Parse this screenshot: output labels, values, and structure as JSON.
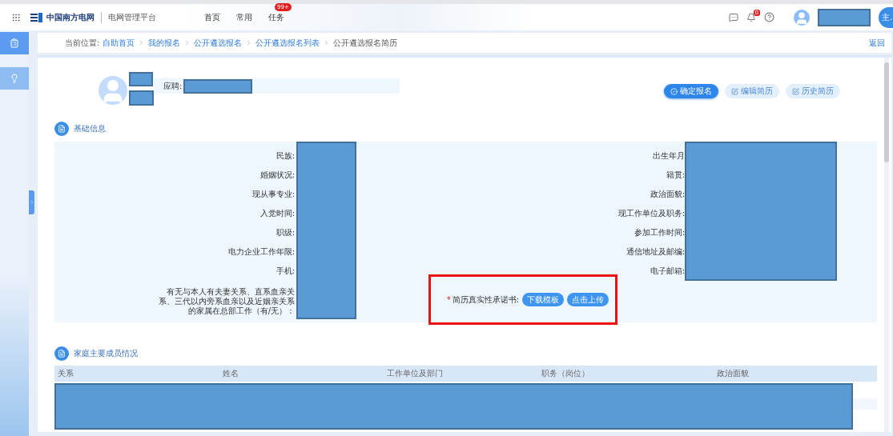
{
  "header": {
    "logo_text": "中国南方电网",
    "app_title": "电网管理平台",
    "nav": [
      {
        "label": "首页"
      },
      {
        "label": "常用"
      },
      {
        "label": "任务",
        "badge": "99+"
      }
    ],
    "notification_badge": "0",
    "user_tab": "主."
  },
  "sidebar": {
    "items": [
      {
        "selected": true
      },
      {
        "selected": false
      }
    ]
  },
  "breadcrumb": {
    "label": "当前位置:",
    "items": [
      {
        "label": "自助首页"
      },
      {
        "label": "我的报名"
      },
      {
        "label": "公开遴选报名"
      },
      {
        "label": "公开遴选报名列表"
      }
    ],
    "current": "公开遴选报名简历",
    "back": "返回"
  },
  "profile": {
    "applied_label": "应聘:",
    "actions": [
      {
        "label": "确定报名",
        "kind": "primary"
      },
      {
        "label": "编辑简历",
        "kind": "secondary"
      },
      {
        "label": "历史简历",
        "kind": "secondary"
      }
    ]
  },
  "basic_info": {
    "title": "基础信息",
    "left_fields": [
      "民族:",
      "婚姻状况:",
      "现从事专业:",
      "入党时间:",
      "职级:",
      "电力企业工作年限:",
      "手机:",
      "有无与本人有夫妻关系、直系血亲关系、三代以内旁系血亲以及近姻亲关系的家属在总部工作（有/无）："
    ],
    "right_fields": [
      "出生年月",
      "籍贯:",
      "政治面貌:",
      "现工作单位及职务:",
      "参加工作时间:",
      "通信地址及邮编:",
      "电子邮箱:"
    ],
    "commitment": {
      "label": "简历真实性承诺书:",
      "required_mark": "*",
      "highlighted": true,
      "buttons": [
        "下载模板",
        "点击上传"
      ]
    }
  },
  "family": {
    "title": "家庭主要成员情况",
    "table": {
      "columns": [
        "关系",
        "姓名",
        "工作单位及部门",
        "职务（岗位）",
        "政治面貌"
      ]
    }
  }
}
